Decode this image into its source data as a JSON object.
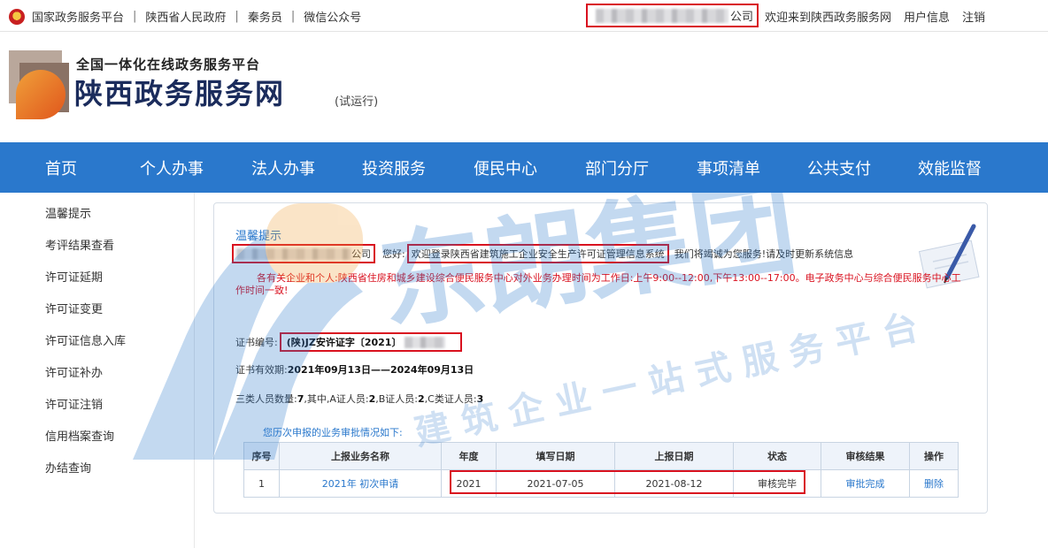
{
  "topbar": {
    "links": [
      "国家政务服务平台",
      "陕西省人民政府",
      "秦务员",
      "微信公众号"
    ],
    "separators": "|",
    "company_suffix": "公司",
    "welcome": "欢迎来到陕西政务服务网",
    "user_info": "用户信息",
    "logout": "注销"
  },
  "header": {
    "slogan": "全国一体化在线政务服务平台",
    "site_name": "陕西政务服务网",
    "trial": "(试运行)"
  },
  "nav": [
    "首页",
    "个人办事",
    "法人办事",
    "投资服务",
    "便民中心",
    "部门分厅",
    "事项清单",
    "公共支付",
    "效能监督"
  ],
  "sidebar": [
    "温馨提示",
    "考评结果查看",
    "许可证延期",
    "许可证变更",
    "许可证信息入库",
    "许可证补办",
    "许可证注销",
    "信用档案查询",
    "办结查询"
  ],
  "main": {
    "title": "温馨提示",
    "company_suffix": "公司",
    "greeting": "您好:",
    "welcome_msg": "欢迎登录陕西省建筑施工企业安全生产许可证管理信息系统",
    "service_msg": "我们将竭诚为您服务!请及时更新系统信息",
    "notice": "各有关企业和个人:陕西省住房和城乡建设综合便民服务中心对外业务办理时间为工作日:上午9:00--12:00,下午13:00--17:00。电子政务中心与综合便民服务中心工作时间一致!",
    "cert_no_label": "证书编号:",
    "cert_no_value": "(陕)JZ安许证字〔2021〕",
    "validity_label": "证书有效期:",
    "validity_value": "2021年09月13日——2024年09月13日",
    "staff_line_prefix": "三类人员数量:",
    "staff_total": "7",
    "staff_mid": ",其中,A证人员:",
    "staff_a": "2",
    "staff_b_label": ",B证人员:",
    "staff_b": "2",
    "staff_c_label": ",C类证人员:",
    "staff_c": "3",
    "history_title": "您历次申报的业务审批情况如下:"
  },
  "table": {
    "headers": [
      "序号",
      "上报业务名称",
      "年度",
      "填写日期",
      "上报日期",
      "状态",
      "审核结果",
      "操作"
    ],
    "rows": [
      [
        "1",
        "2021年 初次申请",
        "2021",
        "2021-07-05",
        "2021-08-12",
        "审核完毕",
        "审批完成",
        "删除"
      ]
    ]
  },
  "watermark": {
    "brand": "东朗集团",
    "tagline": "建筑企业一站式服务平台",
    "color": "#2a78cc"
  }
}
